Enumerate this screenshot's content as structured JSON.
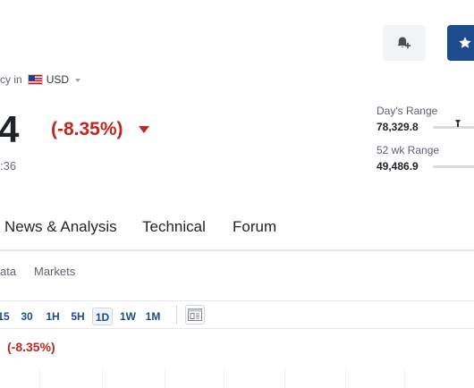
{
  "header": {
    "alert_icon": "bell-plus-icon",
    "watchlist_icon": "star-icon"
  },
  "currency": {
    "prefix": "cy in",
    "code": "USD",
    "flag_icon": "us-flag-icon"
  },
  "quote": {
    "price": "4",
    "change_pct": "(-8.35%)",
    "time": ":36",
    "direction_icon": "down-triangle-icon",
    "colors": {
      "down": "#c3261f",
      "accent": "#1e4a8e"
    }
  },
  "ranges": {
    "day": {
      "label": "Day's Range",
      "value": "78,329.8"
    },
    "week52": {
      "label": "52 wk Range",
      "value": "49,486.9"
    }
  },
  "main_tabs": [
    "News & Analysis",
    "Technical",
    "Forum"
  ],
  "sub_tabs": [
    "ata",
    "Markets"
  ],
  "chart_toolbar": {
    "timeframes": [
      "15",
      "30",
      "1H",
      "5H",
      "1D",
      "1W",
      "1M"
    ],
    "active": "1D",
    "chart_type_icon": "candle-chart-icon"
  },
  "chart": {
    "change_pct": "(-8.35%)"
  }
}
